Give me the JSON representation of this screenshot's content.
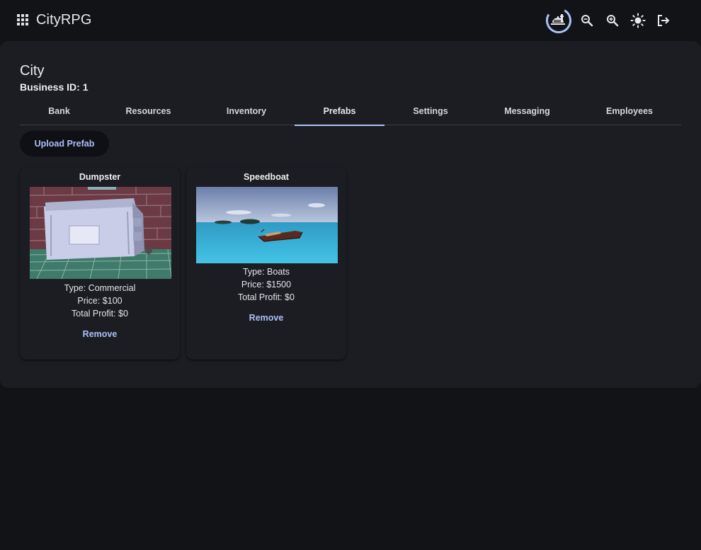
{
  "app": {
    "title": "CityRPG"
  },
  "topbar": {
    "icons": [
      "apps-icon",
      "food-tray-icon",
      "zoom-out-icon",
      "zoom-in-icon",
      "brightness-icon",
      "logout-icon"
    ]
  },
  "business": {
    "name": "City",
    "id_label": "Business ID: 1"
  },
  "tabs": [
    {
      "label": "Bank",
      "active": false
    },
    {
      "label": "Resources",
      "active": false
    },
    {
      "label": "Inventory",
      "active": false
    },
    {
      "label": "Prefabs",
      "active": true
    },
    {
      "label": "Settings",
      "active": false
    },
    {
      "label": "Messaging",
      "active": false
    },
    {
      "label": "Employees",
      "active": false
    }
  ],
  "upload_label": "Upload Prefab",
  "prefabs": [
    {
      "name": "Dumpster",
      "type": "Type: Commercial",
      "price": "Price: $100",
      "profit": "Total Profit: $0",
      "remove_label": "Remove"
    },
    {
      "name": "Speedboat",
      "type": "Type: Boats",
      "price": "Price: $1500",
      "profit": "Total Profit: $0",
      "remove_label": "Remove"
    }
  ],
  "colors": {
    "background": "#121317",
    "card": "#1c1d22",
    "accent": "#a9c1f5",
    "text": "#e4e4ea"
  }
}
